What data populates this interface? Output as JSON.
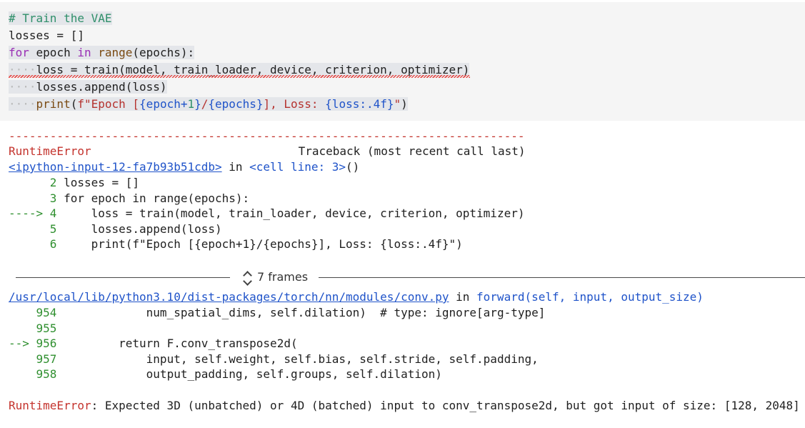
{
  "code": {
    "comment": "# Train the VAE",
    "losses_var": "losses",
    "losses_init": " = []",
    "kw_for": "for",
    "epoch_var": " epoch ",
    "kw_in": "in",
    "fn_range": " range",
    "range_args": "(epochs):",
    "loss_assign": "loss = train(model, train_loader, device, criterion, optimizer)",
    "append_line": "losses.append(loss)",
    "print_fn": "print",
    "print_args_open": "(",
    "print_fstr_a": "f\"Epoch [",
    "print_br1": "{epoch+",
    "print_num": "1",
    "print_br2": "}",
    "print_fstr_b": "/",
    "print_br3": "{epochs}",
    "print_fstr_c": "], Loss: ",
    "print_br4": "{loss:.4f}",
    "print_fstr_d": "\"",
    "print_close": ")"
  },
  "output": {
    "dashes": "---------------------------------------------------------------------------",
    "error_type": "RuntimeError",
    "traceback_header": "Traceback (most recent call last)",
    "input_file": "<ipython-input-12-fa7b93b51cdb>",
    "in_word": " in ",
    "cell_ref": "<cell line: 3>",
    "cell_paren": "()",
    "tb1": [
      {
        "arrow": "      ",
        "num": "2",
        "code": " losses = []"
      },
      {
        "arrow": "      ",
        "num": "3",
        "code": " for epoch in range(epochs):"
      },
      {
        "arrow": "----> ",
        "num": "4",
        "code": "     loss = train(model, train_loader, device, criterion, optimizer)"
      },
      {
        "arrow": "      ",
        "num": "5",
        "code": "     losses.append(loss)"
      },
      {
        "arrow": "      ",
        "num": "6",
        "code": "     print(f\"Epoch [{epoch+1}/{epochs}], Loss: {loss:.4f}\")"
      }
    ],
    "frames_label": "7 frames",
    "conv_file": "/usr/local/lib/python3.10/dist-packages/torch/nn/modules/conv.py",
    "conv_in": " in ",
    "conv_fn": "forward",
    "conv_sig": "(self, input, output_size)",
    "tb2": [
      {
        "arrow": "    ",
        "num": "954",
        "code": "             num_spatial_dims, self.dilation)  # type: ignore[arg-type]"
      },
      {
        "arrow": "    ",
        "num": "955",
        "code": ""
      },
      {
        "arrow": "--> ",
        "num": "956",
        "code": "         return F.conv_transpose2d("
      },
      {
        "arrow": "    ",
        "num": "957",
        "code": "             input, self.weight, self.bias, self.stride, self.padding,"
      },
      {
        "arrow": "    ",
        "num": "958",
        "code": "             output_padding, self.groups, self.dilation)"
      }
    ],
    "final_error_type": "RuntimeError",
    "final_error_msg": ": Expected 3D (unbatched) or 4D (batched) input to conv_transpose2d, but got input of size: [128, 2048]"
  }
}
